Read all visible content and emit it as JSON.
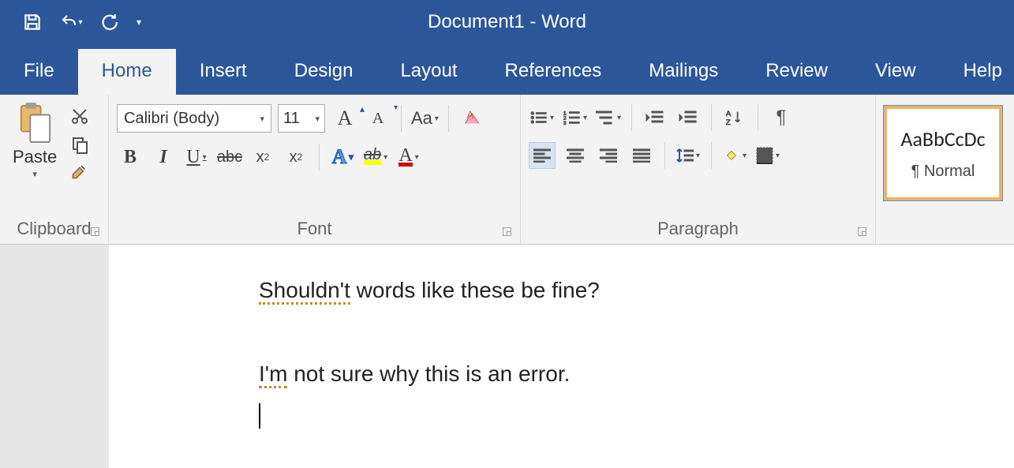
{
  "app": {
    "title": "Document1  -  Word"
  },
  "tabs": {
    "file": "File",
    "home": "Home",
    "insert": "Insert",
    "design": "Design",
    "layout": "Layout",
    "references": "References",
    "mailings": "Mailings",
    "review": "Review",
    "view": "View",
    "help": "Help"
  },
  "clipboard": {
    "paste": "Paste",
    "group": "Clipboard"
  },
  "font": {
    "name": "Calibri (Body)",
    "size": "11",
    "grow": "A",
    "shrink": "A",
    "case": "Aa",
    "bold": "B",
    "italic": "I",
    "underline": "U",
    "strike": "abc",
    "sub": "x",
    "sub2": "2",
    "sup": "x",
    "sup2": "2",
    "eff": "A",
    "hi": "ab",
    "color": "A",
    "group": "Font"
  },
  "para": {
    "group": "Paragraph"
  },
  "styles": {
    "sample": "AaBbCcDc",
    "normal": "¶ Normal"
  },
  "doc": {
    "l1a": "Shouldn't",
    "l1b": " words like these be fine?",
    "l2a": "I'm",
    "l2b": " not sure why this is an error."
  }
}
